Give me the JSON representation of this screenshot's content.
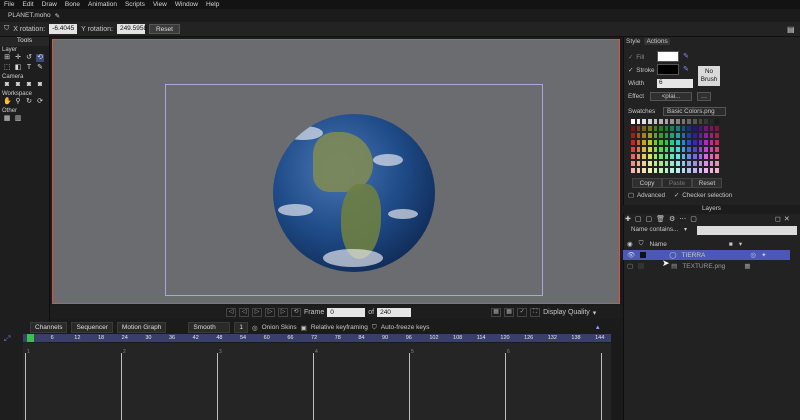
{
  "menu": [
    "File",
    "Edit",
    "Draw",
    "Bone",
    "Animation",
    "Scripts",
    "View",
    "Window",
    "Help"
  ],
  "doc_tab": "PLANET.moho",
  "toolbar": {
    "x_label": "X rotation:",
    "x_value": "-6.4045",
    "y_label": "Y rotation:",
    "y_value": "249.5958",
    "reset": "Reset"
  },
  "tools": {
    "header": "Tools",
    "sections": [
      "Layer",
      "Camera",
      "Workspace",
      "Other"
    ]
  },
  "playback": {
    "frame_label": "Frame",
    "frame_value": "0",
    "of_label": "of",
    "total": "240",
    "display_quality": "Display Quality"
  },
  "timeline": {
    "tabs": [
      "Channels",
      "Sequencer",
      "Motion Graph"
    ],
    "smooth": "Smooth",
    "one": "1",
    "onion": "Onion Skins",
    "relative": "Relative keyframing",
    "autofreeze": "Auto-freeze keys",
    "ruler": [
      "0",
      "6",
      "12",
      "18",
      "24",
      "30",
      "36",
      "42",
      "48",
      "54",
      "60",
      "66",
      "72",
      "78",
      "84",
      "90",
      "96",
      "102",
      "108",
      "114",
      "120",
      "126",
      "132",
      "138",
      "144"
    ],
    "markers": [
      "1",
      "2",
      "3",
      "4",
      "5",
      "6"
    ]
  },
  "style_panel": {
    "tabs": [
      "Style",
      "Actions"
    ],
    "fill": "Fill",
    "stroke": "Stroke",
    "width": "Width",
    "width_value": "6",
    "effect": "Effect",
    "effect_value": "<plai...",
    "no_brush": "No Brush",
    "swatches_label": "Swatches",
    "swatches_file": "Basic Colors.png",
    "copy": "Copy",
    "paste": "Paste",
    "reset": "Reset",
    "advanced": "Advanced",
    "checker": "Checker selection"
  },
  "layers_panel": {
    "header": "Layers",
    "filter": "Name contains...",
    "name_col": "Name",
    "layers": [
      {
        "name": "TIERRA"
      },
      {
        "name": "TEXTURE.png"
      }
    ]
  }
}
